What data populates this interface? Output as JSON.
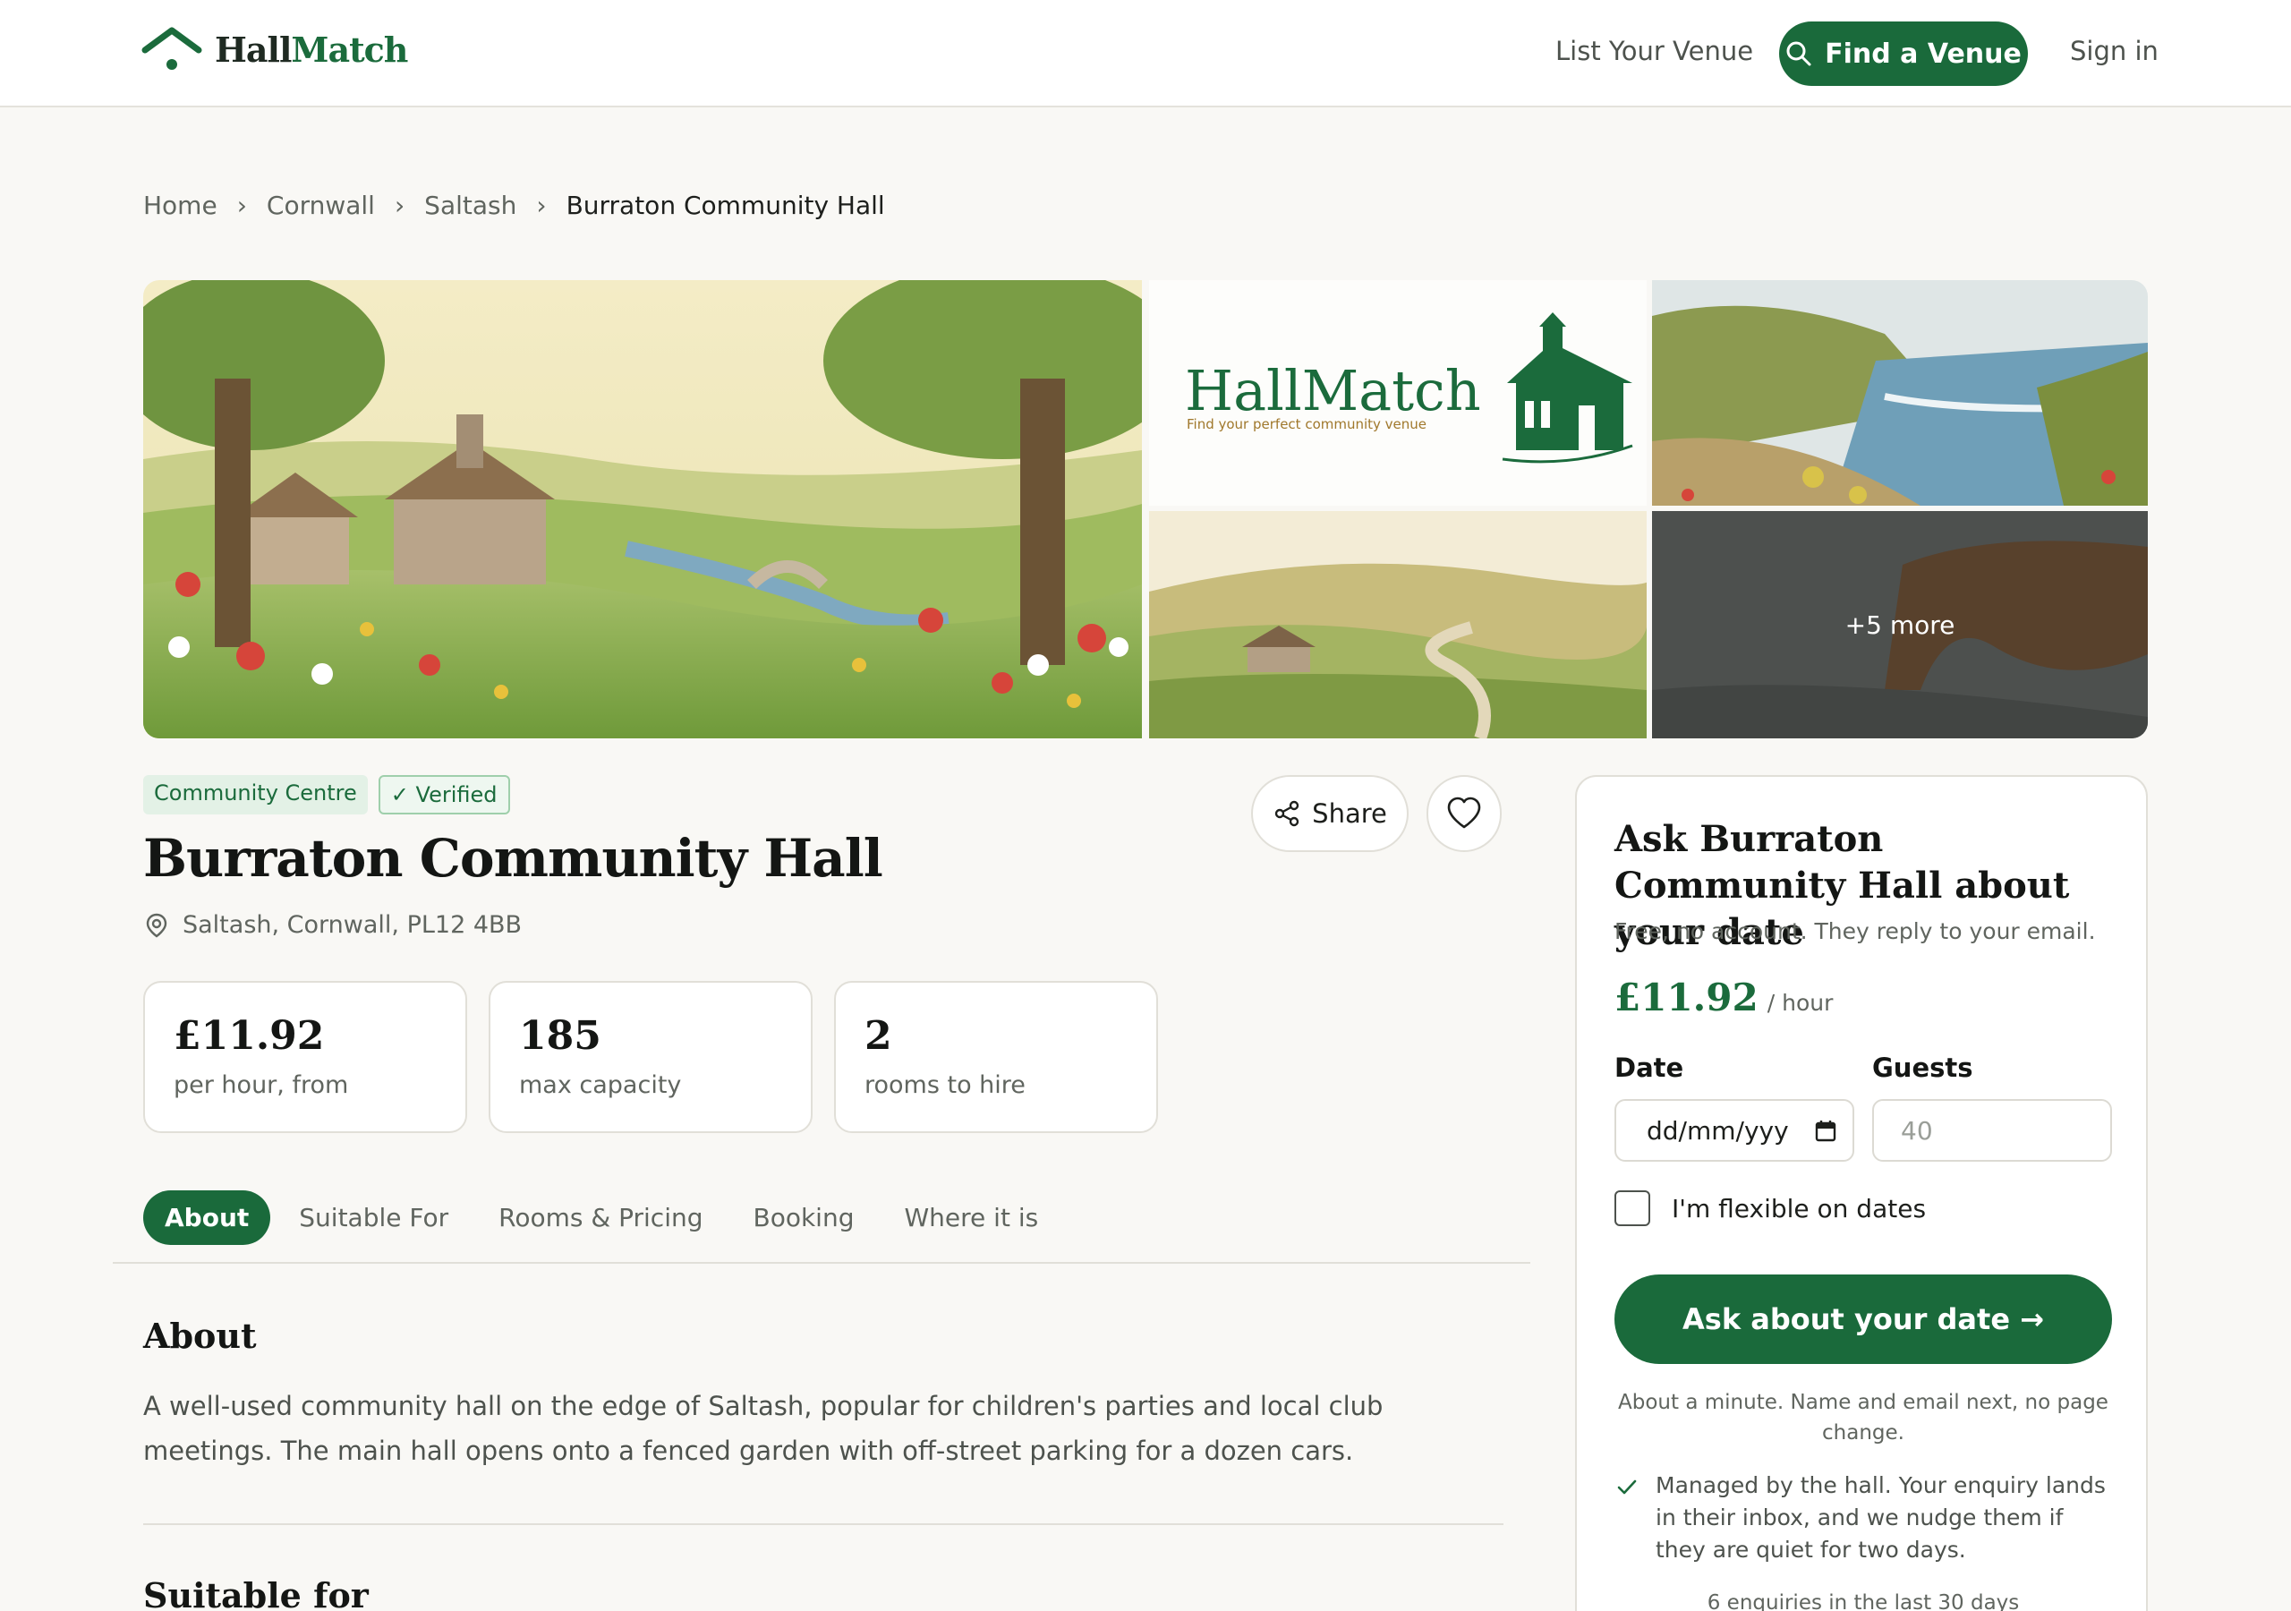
{
  "header": {
    "logo_text_a": "Hall",
    "logo_text_b": "Match",
    "nav_list_venue": "List Your Venue",
    "find_venue": "Find a Venue",
    "sign_in": "Sign in"
  },
  "breadcrumb": {
    "items": [
      "Home",
      "Cornwall",
      "Saltash"
    ],
    "current": "Burraton Community Hall"
  },
  "gallery": {
    "logo_title": "HallMatch",
    "logo_tagline": "Find your perfect community venue",
    "more_label": "+5 more"
  },
  "venue": {
    "tags": [
      "Community Centre",
      "Verified"
    ],
    "title": "Burraton Community Hall",
    "location": "Saltash, Cornwall, PL12 4BB",
    "share_label": "Share",
    "stats": [
      {
        "value": "£11.92",
        "label": "per hour, from"
      },
      {
        "value": "185",
        "label": "max capacity"
      },
      {
        "value": "2",
        "label": "rooms to hire"
      }
    ]
  },
  "tabs": [
    "About",
    "Suitable For",
    "Rooms & Pricing",
    "Booking",
    "Where it is"
  ],
  "about": {
    "heading": "About",
    "text": "A well-used community hall on the edge of Saltash, popular for children's parties and local club meetings. The main hall opens onto a fenced garden with off-street parking for a dozen cars."
  },
  "suitable": {
    "heading": "Suitable for"
  },
  "enquiry": {
    "heading": "Ask Burraton Community Hall about your date",
    "subtext": "Free, no account. They reply to your email.",
    "price": "£11.92",
    "price_unit": "/ hour",
    "date_label": "Date",
    "guests_label": "Guests",
    "date_value": "dd/mm/yyy",
    "guests_placeholder": "40",
    "flexible_label": "I'm flexible on dates",
    "cta_label": "Ask about your date →",
    "note": "About a minute. Name and email next, no page change.",
    "managed_text": "Managed by the hall. Your enquiry lands in their inbox, and we nudge them if they are quiet for two days.",
    "enquiries_count": "6 enquiries in the last 30 days"
  },
  "colors": {
    "brand_green": "#1a6a3b",
    "background": "#f9f8f5",
    "border": "#e1dfd8"
  },
  "icons": [
    "logo-roof-icon",
    "search-icon",
    "chevron-right-icon",
    "check-icon",
    "location-pin-icon",
    "share-icon",
    "heart-icon",
    "calendar-icon",
    "checkmark-icon"
  ]
}
